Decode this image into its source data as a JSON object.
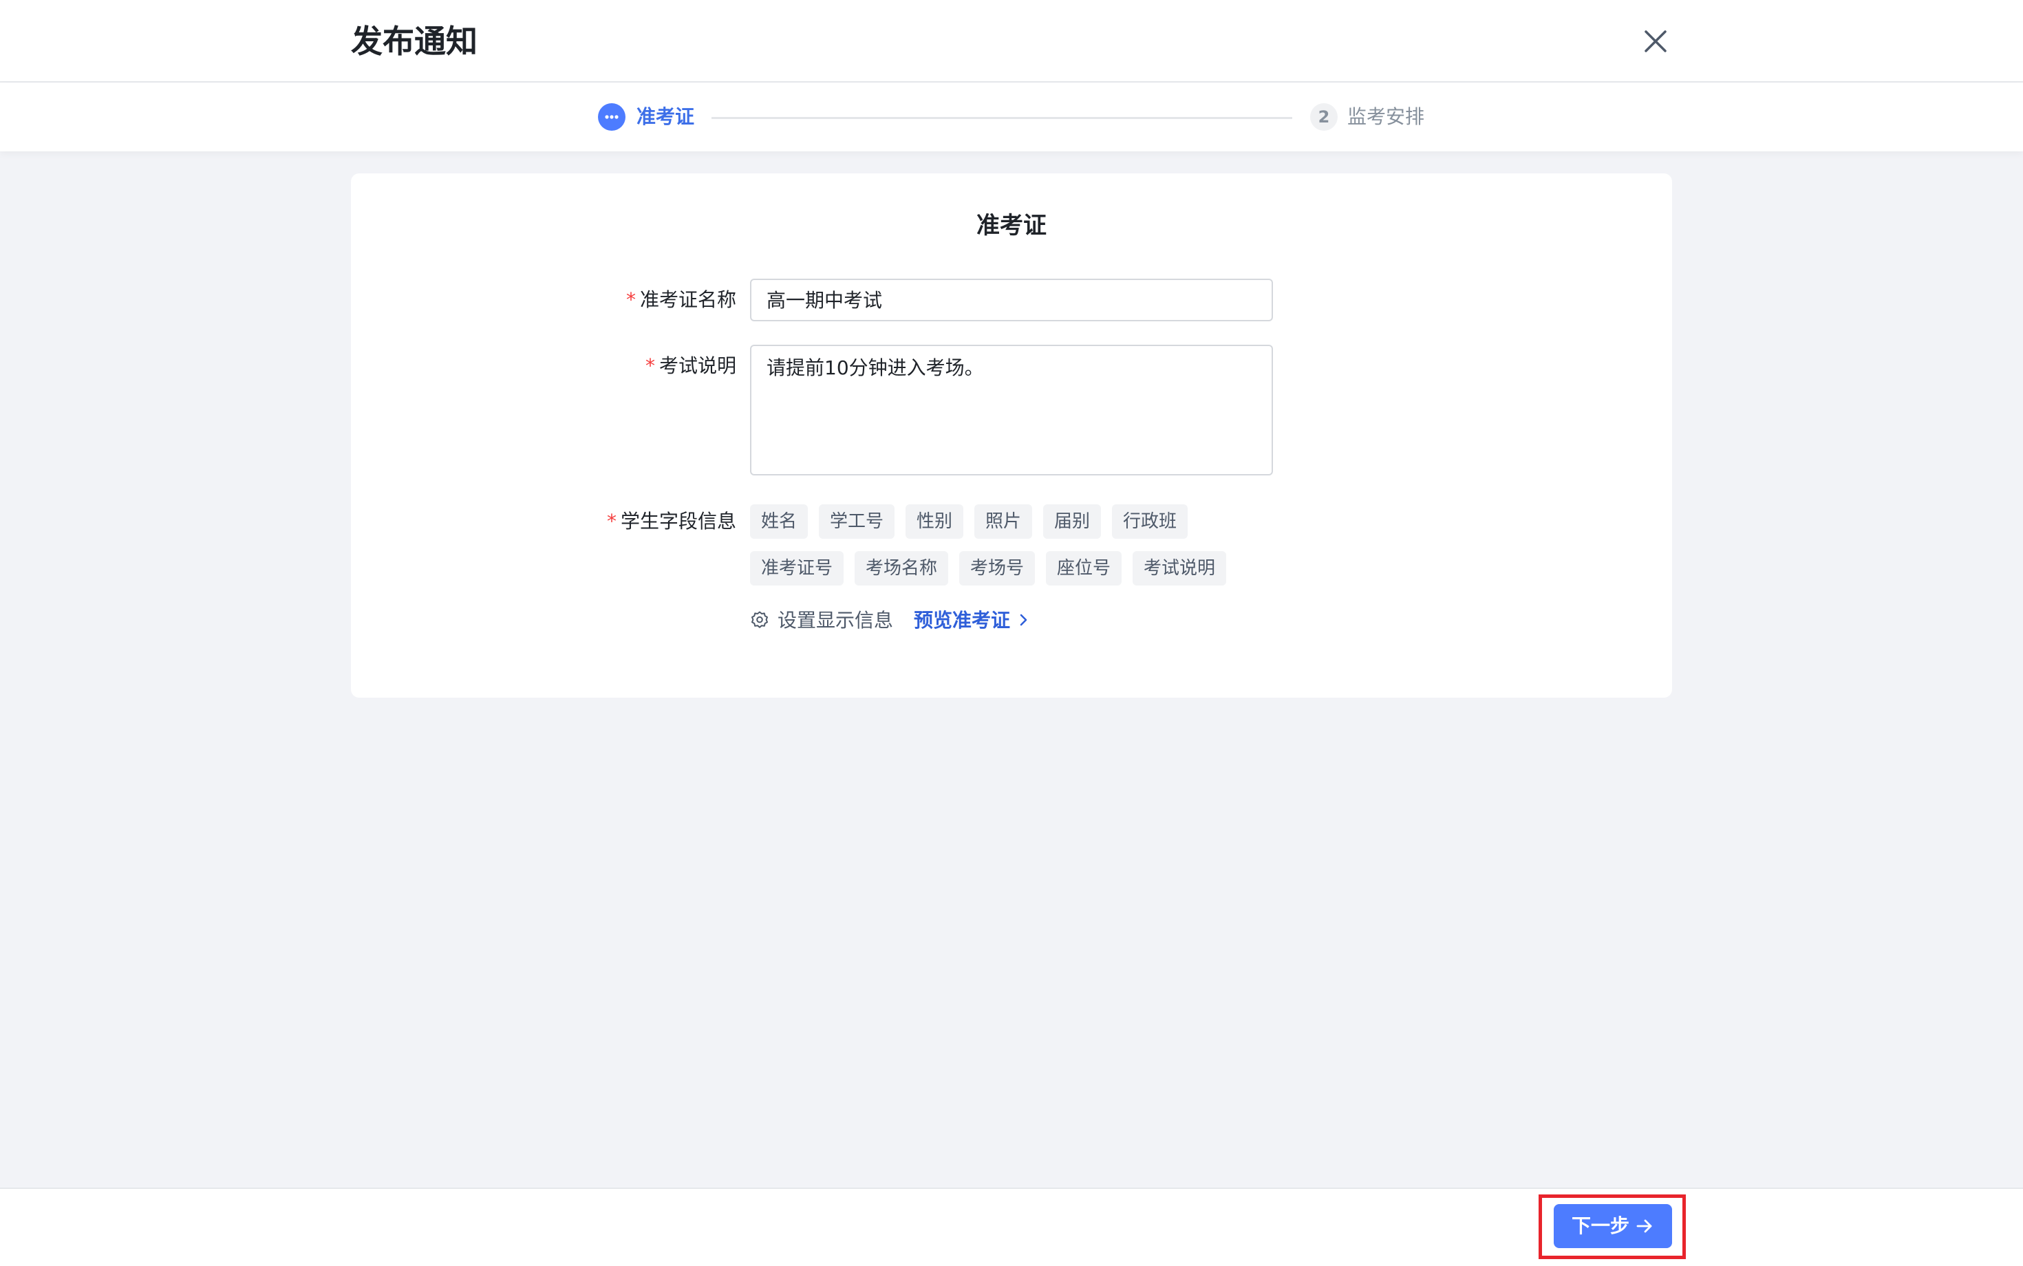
{
  "header": {
    "title": "发布通知",
    "close_icon": "close-icon"
  },
  "steps": {
    "step1": {
      "label": "准考证",
      "icon": "more-dots-icon",
      "state": "active"
    },
    "step2": {
      "number": "2",
      "label": "监考安排",
      "state": "pending"
    }
  },
  "card": {
    "title": "准考证",
    "fields": {
      "name": {
        "required_mark": "*",
        "label": "准考证名称",
        "value": "高一期中考试"
      },
      "description": {
        "required_mark": "*",
        "label": "考试说明",
        "value": "请提前10分钟进入考场。"
      },
      "student_fields": {
        "required_mark": "*",
        "label": "学生字段信息",
        "tags": [
          "姓名",
          "学工号",
          "性别",
          "照片",
          "届别",
          "行政班",
          "准考证号",
          "考场名称",
          "考场号",
          "座位号",
          "考试说明"
        ]
      }
    },
    "settings_label": "设置显示信息",
    "settings_icon": "gear-icon",
    "preview_label": "预览准考证",
    "preview_icon": "chevron-right-icon"
  },
  "footer": {
    "next_label": "下一步",
    "next_icon": "arrow-right-icon"
  },
  "colors": {
    "accent": "#4d7cff",
    "link": "#2f5fd9",
    "required": "#f53f3f",
    "highlight": "#e8242c"
  }
}
